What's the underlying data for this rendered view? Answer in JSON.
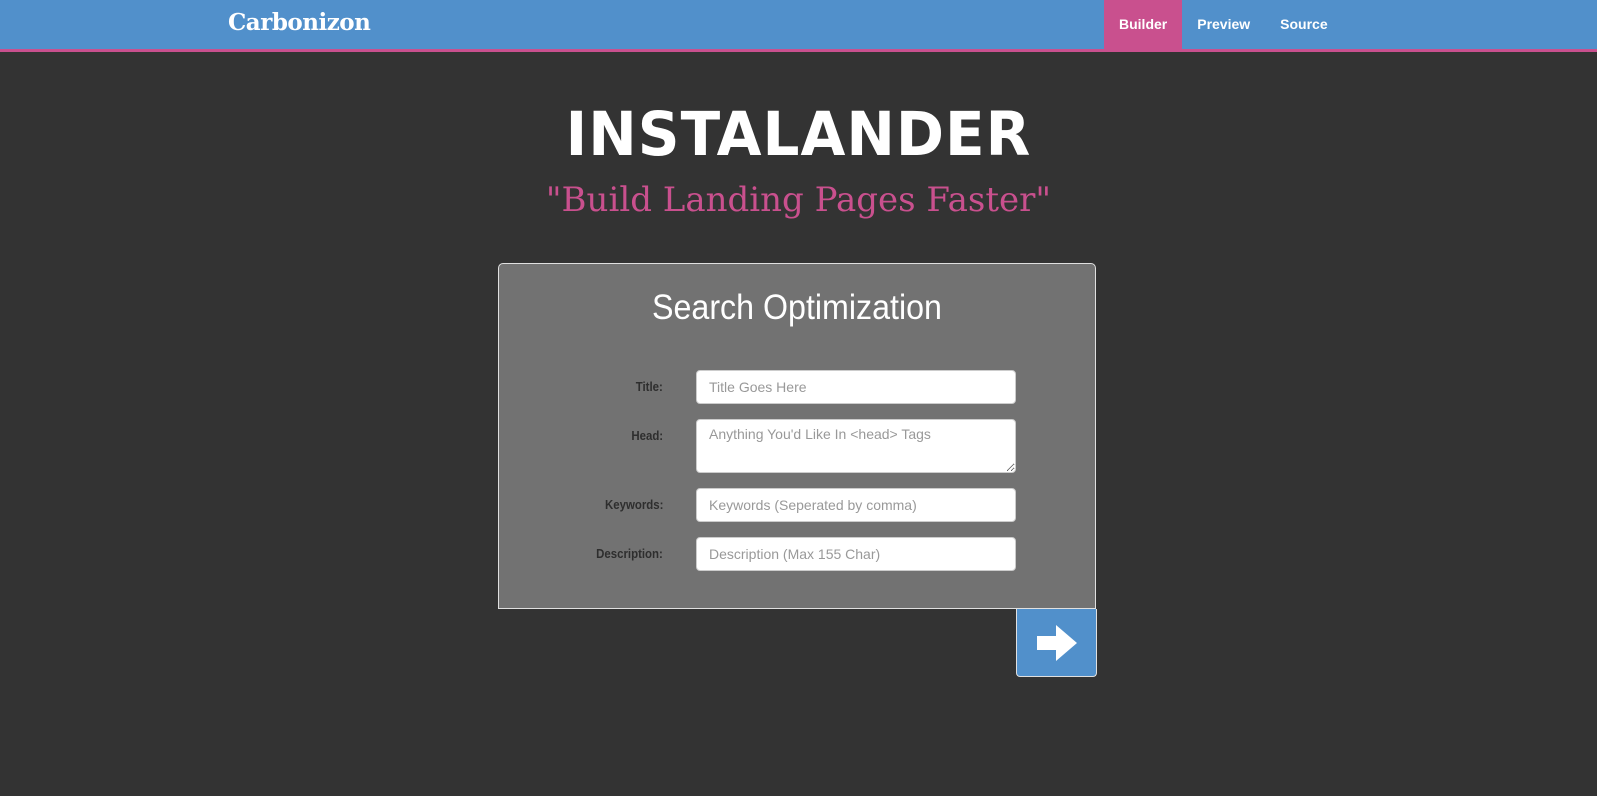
{
  "navbar": {
    "brand": "Carbonizon",
    "items": [
      {
        "label": "Builder",
        "active": true
      },
      {
        "label": "Preview",
        "active": false
      },
      {
        "label": "Source",
        "active": false
      }
    ]
  },
  "hero": {
    "title": "INSTALANDER",
    "subtitle": "\"Build Landing Pages Faster\""
  },
  "form": {
    "title": "Search Optimization",
    "fields": [
      {
        "label": "Title:",
        "placeholder": "Title Goes Here",
        "value": ""
      },
      {
        "label": "Head:",
        "placeholder": "Anything You'd Like In <head> Tags",
        "value": ""
      },
      {
        "label": "Keywords:",
        "placeholder": "Keywords (Seperated by comma)",
        "value": ""
      },
      {
        "label": "Description:",
        "placeholder": "Description (Max 155 Char)",
        "value": ""
      }
    ]
  },
  "next_button": {
    "icon": "arrow-right-icon"
  },
  "colors": {
    "navbar": "#5190cb",
    "accent": "#c9508e",
    "background": "#333333",
    "panel": "#727272"
  }
}
